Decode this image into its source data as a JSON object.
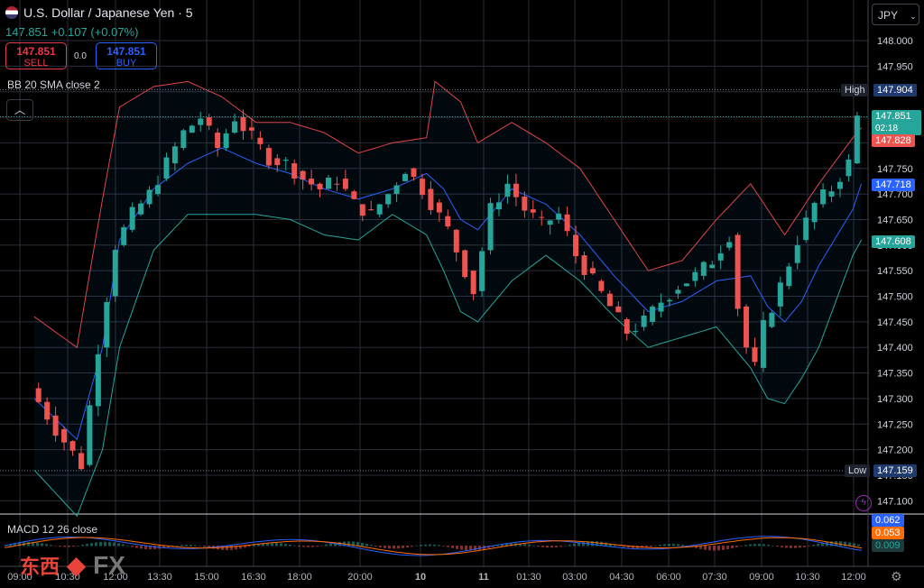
{
  "header": {
    "symbol": "U.S. Dollar / Japanese Yen · 5",
    "flag_icon": "us-jp-flag-icon",
    "price_change": "147.851 +0.107 (+0.07%)",
    "sell_price": "147.851",
    "sell_label": "SELL",
    "spread": "0.0",
    "buy_price": "147.851",
    "buy_label": "BUY",
    "currency": "JPY",
    "indicator_bb": "BB 20 SMA close 2",
    "indicator_macd": "MACD 12 26 close"
  },
  "tags": {
    "high_label": "High",
    "high_value": "147.904",
    "last_value": "147.851",
    "countdown": "02:18",
    "upper_band": "147.828",
    "basis": "147.718",
    "lower_band": "147.608",
    "low_label": "Low",
    "low_value": "147.159",
    "macd_value": "0.062",
    "signal_value": "0.053",
    "hist_value": "0.009"
  },
  "watermark": {
    "cn": "东西",
    "fx": "FX"
  },
  "chart_data": {
    "type": "candlestick",
    "interval": "5",
    "price_axis": [
      "148.000",
      "147.950",
      "147.900",
      "147.850",
      "147.800",
      "147.750",
      "147.700",
      "147.650",
      "147.600",
      "147.550",
      "147.500",
      "147.450",
      "147.400",
      "147.350",
      "147.300",
      "147.250",
      "147.200",
      "147.150",
      "147.100"
    ],
    "time_axis": [
      "09:00",
      "10:30",
      "12:00",
      "13:30",
      "15:00",
      "16:30",
      "18:00",
      "20:00",
      "10",
      "11",
      "01:30",
      "03:00",
      "04:30",
      "06:00",
      "07:30",
      "09:00",
      "10:30",
      "12:00"
    ],
    "ylim": [
      147.08,
      148.03
    ],
    "grid": true,
    "price_path": [
      [
        0,
        147.32
      ],
      [
        3,
        147.24
      ],
      [
        6,
        147.17
      ],
      [
        8,
        147.4
      ],
      [
        10,
        147.6
      ],
      [
        12,
        147.66
      ],
      [
        14,
        147.7
      ],
      [
        16,
        147.76
      ],
      [
        18,
        147.82
      ],
      [
        20,
        147.85
      ],
      [
        22,
        147.79
      ],
      [
        24,
        147.85
      ],
      [
        26,
        147.81
      ],
      [
        28,
        147.77
      ],
      [
        30,
        147.76
      ],
      [
        32,
        147.73
      ],
      [
        34,
        147.71
      ],
      [
        36,
        147.73
      ],
      [
        38,
        147.68
      ],
      [
        40,
        147.66
      ],
      [
        42,
        147.7
      ],
      [
        44,
        147.75
      ],
      [
        46,
        147.71
      ],
      [
        49,
        147.63
      ],
      [
        52,
        147.51
      ],
      [
        54,
        147.67
      ],
      [
        56,
        147.72
      ],
      [
        58,
        147.67
      ],
      [
        60,
        147.64
      ],
      [
        62,
        147.66
      ],
      [
        64,
        147.58
      ],
      [
        66,
        147.53
      ],
      [
        68,
        147.48
      ],
      [
        70,
        147.43
      ],
      [
        72,
        147.45
      ],
      [
        74,
        147.49
      ],
      [
        76,
        147.52
      ],
      [
        78,
        147.54
      ],
      [
        80,
        147.57
      ],
      [
        82,
        147.62
      ],
      [
        83,
        147.48
      ],
      [
        84,
        147.4
      ],
      [
        85,
        147.36
      ],
      [
        86,
        147.44
      ],
      [
        88,
        147.52
      ],
      [
        90,
        147.61
      ],
      [
        92,
        147.68
      ],
      [
        94,
        147.71
      ],
      [
        96,
        147.76
      ],
      [
        97,
        147.85
      ]
    ],
    "bb_upper": [
      [
        0,
        147.46
      ],
      [
        5,
        147.4
      ],
      [
        8,
        147.69
      ],
      [
        10,
        147.87
      ],
      [
        14,
        147.91
      ],
      [
        18,
        147.92
      ],
      [
        22,
        147.89
      ],
      [
        26,
        147.84
      ],
      [
        30,
        147.84
      ],
      [
        34,
        147.82
      ],
      [
        38,
        147.78
      ],
      [
        42,
        147.8
      ],
      [
        46,
        147.81
      ],
      [
        47,
        147.92
      ],
      [
        50,
        147.88
      ],
      [
        52,
        147.8
      ],
      [
        56,
        147.84
      ],
      [
        60,
        147.8
      ],
      [
        64,
        147.75
      ],
      [
        68,
        147.65
      ],
      [
        72,
        147.55
      ],
      [
        76,
        147.57
      ],
      [
        80,
        147.65
      ],
      [
        84,
        147.72
      ],
      [
        88,
        147.62
      ],
      [
        92,
        147.72
      ],
      [
        96,
        147.81
      ],
      [
        97,
        147.83
      ]
    ],
    "bb_basis": [
      [
        0,
        147.3
      ],
      [
        5,
        147.22
      ],
      [
        8,
        147.4
      ],
      [
        10,
        147.61
      ],
      [
        14,
        147.71
      ],
      [
        18,
        147.76
      ],
      [
        22,
        147.79
      ],
      [
        26,
        147.76
      ],
      [
        30,
        147.74
      ],
      [
        34,
        147.71
      ],
      [
        38,
        147.69
      ],
      [
        42,
        147.71
      ],
      [
        46,
        147.74
      ],
      [
        48,
        147.71
      ],
      [
        50,
        147.65
      ],
      [
        52,
        147.63
      ],
      [
        56,
        147.71
      ],
      [
        60,
        147.68
      ],
      [
        64,
        147.62
      ],
      [
        68,
        147.54
      ],
      [
        72,
        147.47
      ],
      [
        76,
        147.49
      ],
      [
        80,
        147.53
      ],
      [
        84,
        147.54
      ],
      [
        86,
        147.48
      ],
      [
        88,
        147.45
      ],
      [
        90,
        147.49
      ],
      [
        92,
        147.56
      ],
      [
        96,
        147.67
      ],
      [
        97,
        147.72
      ]
    ],
    "bb_lower": [
      [
        0,
        147.16
      ],
      [
        5,
        147.07
      ],
      [
        8,
        147.2
      ],
      [
        10,
        147.4
      ],
      [
        14,
        147.59
      ],
      [
        18,
        147.66
      ],
      [
        22,
        147.66
      ],
      [
        26,
        147.66
      ],
      [
        30,
        147.65
      ],
      [
        34,
        147.62
      ],
      [
        38,
        147.61
      ],
      [
        42,
        147.66
      ],
      [
        46,
        147.62
      ],
      [
        48,
        147.55
      ],
      [
        50,
        147.47
      ],
      [
        52,
        147.45
      ],
      [
        56,
        147.53
      ],
      [
        60,
        147.58
      ],
      [
        64,
        147.53
      ],
      [
        68,
        147.46
      ],
      [
        72,
        147.4
      ],
      [
        76,
        147.42
      ],
      [
        80,
        147.44
      ],
      [
        84,
        147.36
      ],
      [
        86,
        147.3
      ],
      [
        88,
        147.29
      ],
      [
        90,
        147.34
      ],
      [
        92,
        147.4
      ],
      [
        96,
        147.58
      ],
      [
        97,
        147.61
      ]
    ],
    "high": 147.904,
    "low": 147.159,
    "last": 147.851,
    "colors": {
      "up": "#26a69a",
      "down": "#ef5350",
      "upper": "#e0444c",
      "basis": "#2962ff",
      "lower": "#26a69a",
      "macd": "#2962ff",
      "signal": "#ff6d00"
    }
  }
}
